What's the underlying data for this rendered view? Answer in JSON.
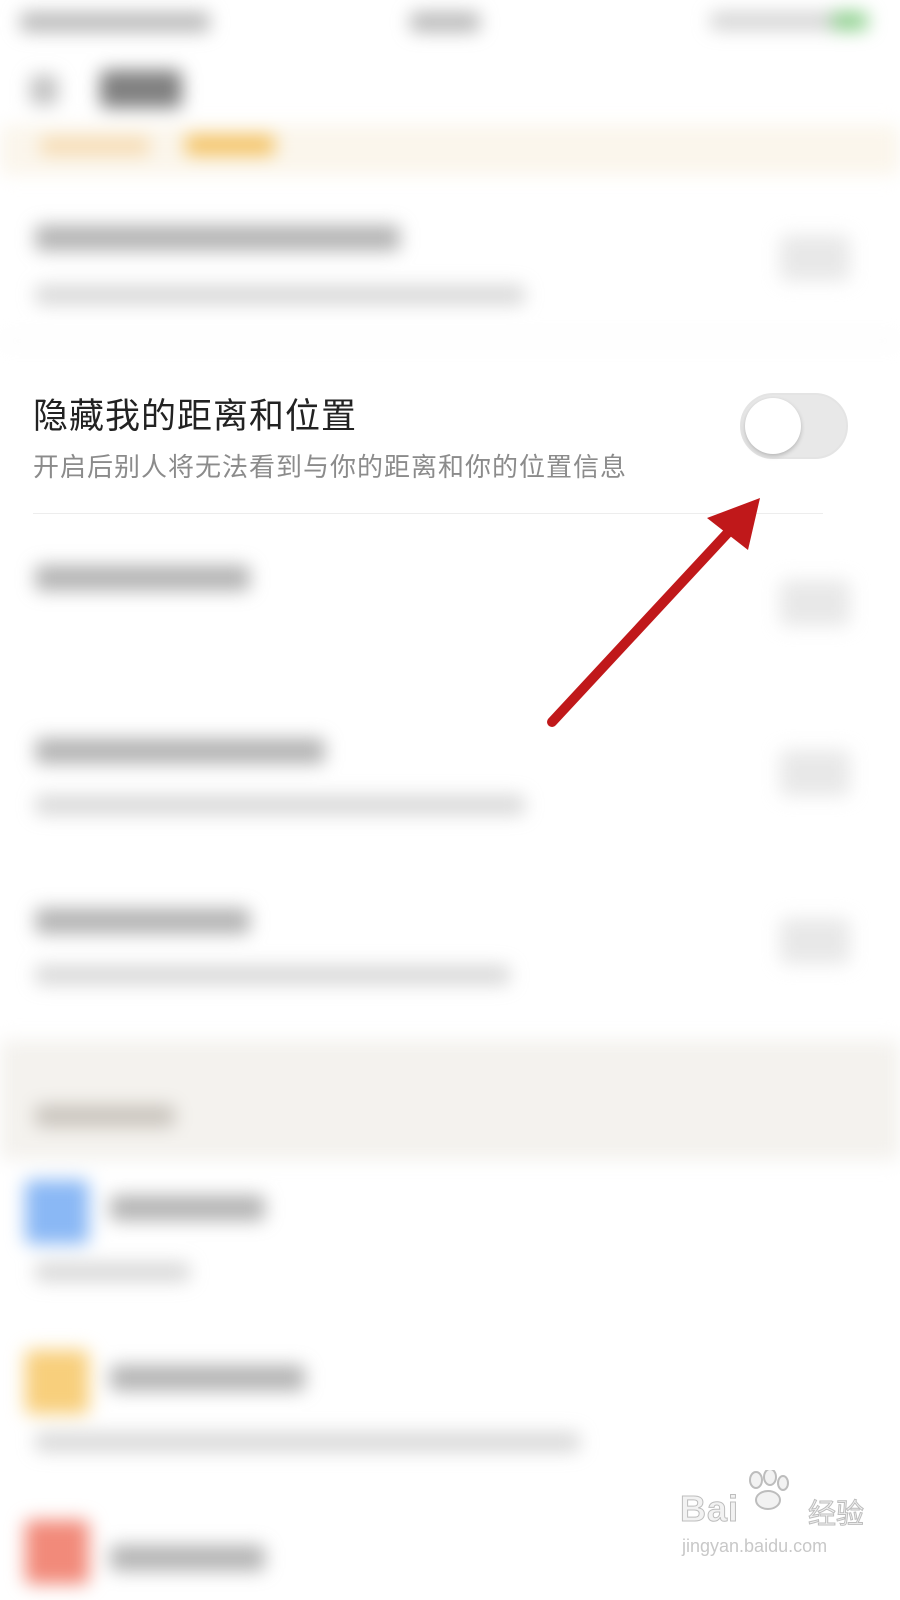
{
  "setting_row": {
    "title": "隐藏我的距离和位置",
    "subtitle": "开启后别人将无法看到与你的距离和你的位置信息",
    "toggle_on": false
  },
  "annotation": {
    "arrow_color": "#c0181a",
    "arrow_target": "toggle"
  },
  "watermark": {
    "brand": "Bai",
    "brand_cn": "经验",
    "url": "jingyan.baidu.com"
  },
  "colors": {
    "accent": "#f2b540",
    "toggle_off": "#e8e8e8",
    "title_text": "#222222",
    "subtitle_text": "#8b8b8b"
  },
  "icons": [
    "back-arrow-icon",
    "battery-icon",
    "baidu-paw-icon",
    "toggle-knob"
  ]
}
